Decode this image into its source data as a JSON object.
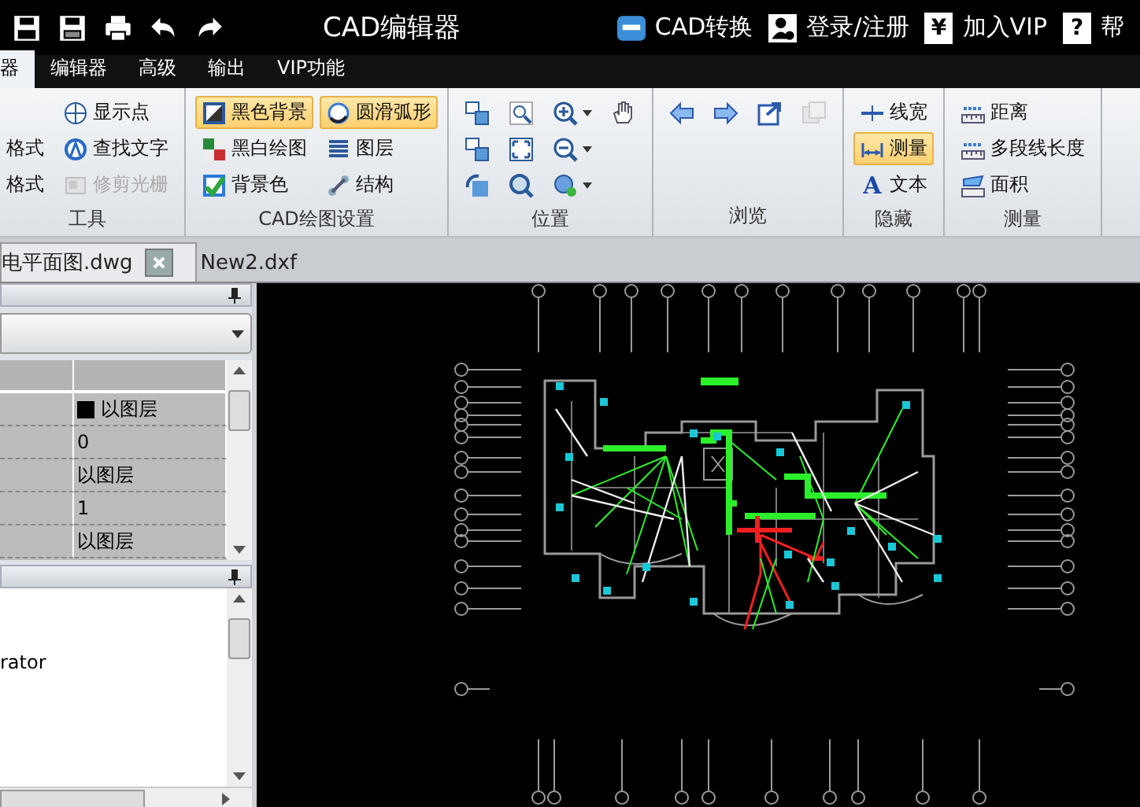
{
  "title_bar": {
    "quick_actions": [
      {
        "kind": "save"
      },
      {
        "kind": "save-pdf"
      },
      {
        "kind": "print"
      },
      {
        "kind": "undo"
      },
      {
        "kind": "redo"
      }
    ],
    "title": "CAD编辑器",
    "links": [
      {
        "kind": "cad",
        "label": "CAD转换"
      },
      {
        "kind": "user",
        "label": "登录/注册"
      },
      {
        "kind": "char",
        "badge": "¥",
        "label": "加入VIP"
      },
      {
        "kind": "char",
        "badge": "?",
        "label": "帮"
      }
    ]
  },
  "menu_tabs": [
    {
      "label": "器",
      "selected": true
    },
    {
      "label": "编辑器",
      "selected": false
    },
    {
      "label": "高级",
      "selected": false
    },
    {
      "label": "输出",
      "selected": false
    },
    {
      "label": "VIP功能",
      "selected": false
    }
  ],
  "ribbon": {
    "groups": [
      {
        "title": "工具",
        "columns": [
          [
            {
              "label": "格式",
              "selected": false,
              "disabled": false
            },
            {
              "label": "格式",
              "selected": false,
              "disabled": false
            }
          ],
          [
            {
              "kind": "target",
              "label": "显示点",
              "selected": false,
              "disabled": false
            },
            {
              "kind": "find",
              "label": "查找文字",
              "selected": false,
              "disabled": false
            },
            {
              "kind": "trim",
              "label": "修剪光栅",
              "selected": false,
              "disabled": true
            }
          ]
        ]
      },
      {
        "title": "CAD绘图设置",
        "columns": [
          [
            {
              "kind": "black-bg",
              "label": "黑色背景",
              "selected": true,
              "disabled": false
            },
            {
              "kind": "bw",
              "label": "黑白绘图",
              "selected": false,
              "disabled": false
            },
            {
              "kind": "bg-color",
              "label": "背景色",
              "selected": false,
              "disabled": false
            }
          ],
          [
            {
              "kind": "arc",
              "label": "圆滑弧形",
              "selected": true,
              "disabled": false
            },
            {
              "kind": "layers",
              "label": "图层",
              "selected": false,
              "disabled": false
            },
            {
              "kind": "structure",
              "label": "结构",
              "selected": false,
              "disabled": false
            }
          ]
        ]
      },
      {
        "title": "位置",
        "columns": [
          [
            {
              "kind": "view"
            },
            {
              "kind": "view"
            },
            {
              "kind": "rotate"
            }
          ],
          [
            {
              "kind": "zoom-window"
            },
            {
              "kind": "fit"
            },
            {
              "kind": "zoom-real"
            }
          ],
          [
            {
              "kind": "zoom-in",
              "dropdown": true
            },
            {
              "kind": "zoom-out",
              "dropdown": true
            },
            {
              "kind": "orbit",
              "dropdown": true
            }
          ],
          [
            {
              "kind": "hand"
            }
          ]
        ]
      },
      {
        "title": "浏览",
        "columns": [
          [
            {
              "kind": "left"
            }
          ],
          [
            {
              "kind": "right"
            }
          ],
          [
            {
              "kind": "open"
            }
          ],
          [
            {
              "kind": "copy",
              "disabled": true
            }
          ]
        ]
      },
      {
        "title": "隐藏",
        "columns": [
          [
            {
              "kind": "lineweight",
              "label": "线宽",
              "selected": false,
              "disabled": false
            },
            {
              "kind": "measure",
              "label": "测量",
              "selected": true,
              "disabled": false
            },
            {
              "kind": "text",
              "badge": "A",
              "label": "文本",
              "selected": false,
              "disabled": false
            }
          ]
        ]
      },
      {
        "title": "测量",
        "columns": [
          [
            {
              "kind": "ruler",
              "label": "距离",
              "selected": false,
              "disabled": false
            },
            {
              "kind": "ruler",
              "label": "多段线长度",
              "selected": false,
              "disabled": false
            },
            {
              "kind": "area",
              "label": "面积",
              "selected": false,
              "disabled": false
            }
          ]
        ]
      }
    ]
  },
  "doc_tabs": [
    {
      "label": "电平面图.dwg",
      "selected": true,
      "closable": true
    },
    {
      "label": "New2.dxf",
      "selected": false,
      "closable": false
    }
  ],
  "properties": {
    "rows": [
      {
        "kind": "color",
        "value": "以图层"
      },
      {
        "kind": "text",
        "value": "0"
      },
      {
        "kind": "text",
        "value": "以图层"
      },
      {
        "kind": "text",
        "value": "1"
      },
      {
        "kind": "text",
        "value": "以图层"
      }
    ]
  },
  "info_panel": {
    "text": "rator"
  }
}
